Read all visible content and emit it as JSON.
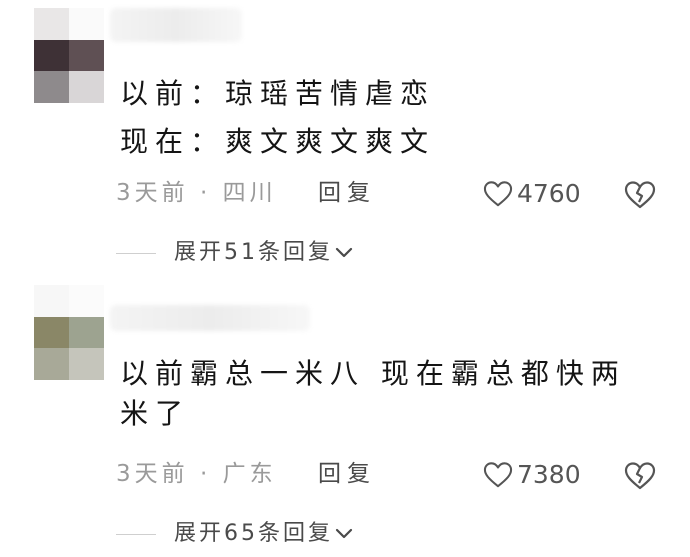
{
  "comments": [
    {
      "lines": [
        "以前：琼瑶苦情虐恋",
        "现在：爽文爽文爽文"
      ],
      "time": "3天前",
      "location": "四川",
      "reply_label": "回复",
      "likes": "4760",
      "expand_label": "展开51条回复"
    },
    {
      "lines": [
        "以前霸总一米八  现在霸总都快两米了"
      ],
      "time": "3天前",
      "location": "广东",
      "reply_label": "回复",
      "likes": "7380",
      "expand_label": "展开65条回复"
    }
  ],
  "colors": {
    "text": "#151515",
    "meta": "#9a9a9a",
    "icon": "#555555"
  },
  "icons": [
    "heart-icon",
    "broken-heart-icon",
    "chevron-down-icon"
  ]
}
